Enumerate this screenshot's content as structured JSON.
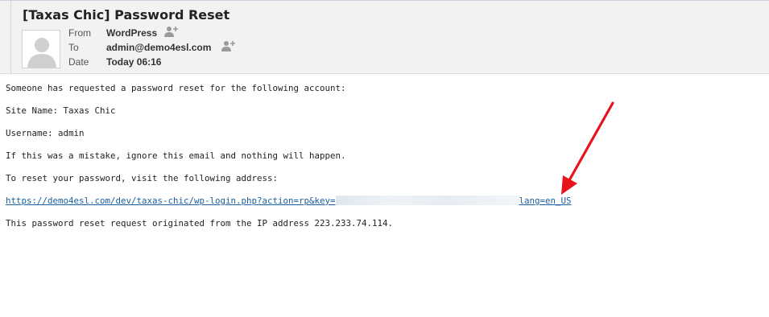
{
  "email": {
    "subject": "[Taxas Chic] Password Reset",
    "from_label": "From",
    "from_value": "WordPress",
    "to_label": "To",
    "to_value": "admin@demo4esl.com",
    "date_label": "Date",
    "date_value": "Today 06:16"
  },
  "body": {
    "line1": "Someone has requested a password reset for the following account:",
    "line2": "Site Name: Taxas Chic",
    "line3": "Username: admin",
    "line4": "If this was a mistake, ignore this email and nothing will happen.",
    "line5": "To reset your password, visit the following address:",
    "link_start": "https://demo4esl.com/dev/taxas-chic/wp-login.php?action=rp&key=",
    "link_end": "lang=en_US",
    "line7": "This password reset request originated from the IP address 223.233.74.114."
  },
  "colors": {
    "link": "#1a5fa0",
    "arrow": "#e8131b",
    "header_bg": "#f2f2f2"
  },
  "icons": [
    "avatar-placeholder",
    "add-contact-icon",
    "red-arrow-annotation"
  ]
}
